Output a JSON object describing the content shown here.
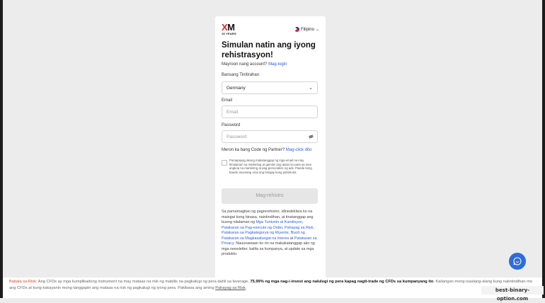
{
  "logo": {
    "mark_x": "X",
    "mark_m": "M",
    "years": "15 YEARS"
  },
  "language": {
    "label": "Filipino"
  },
  "form": {
    "title": "Simulan natin ang iyong rehistrasyon!",
    "login_prompt": "Mayroon nang account?",
    "login_link": "Mag-login",
    "country_label": "Bansang Tinitirahan",
    "country_value": "Germany",
    "email_label": "Email",
    "email_placeholder": "Email",
    "password_label": "Password",
    "password_placeholder": "Password",
    "partner_prompt": "Meron ka bang Code ng Partner?",
    "partner_link": "Mag-click dito",
    "consent_text": "Pumapayag akong makatanggap ng mga email na may kinalaman sa marketing at gamitin ang datos ko para sa mas angkop na marketing at pag-personalize ng ads. Pwede kong bawiin anumang oras ang binigay kong pahintulot.",
    "consent_checked": false,
    "submit_label": "Mag-rehistro",
    "legal_pre": "Sa pamamagitan ng pagrerehistro, idinedeklara ko na maingat kong binasa, naintindihan, at tinatanggap ang buong nilalaman ng ",
    "legal_links": "Mga Tuntunin at Kundisyon, Patakaran sa Pag-execute ng Order, Pahayag sa Risk, Patakaran sa Pagkategorya ng Kliyente, Buod ng Patakaran sa Magkasalungat na Interes",
    "legal_mid": " at ",
    "legal_privacy": "Patakaran sa Privacy",
    "legal_post": ". Nauunawaan ko rin na makakatanggap ako ng mga newsletter, balita sa kumpanya, at update sa mga produkto."
  },
  "risk_warning": {
    "label": "Babala sa Risk:",
    "text1": " Ang CFDs ay mga kumplikadong instrument na may mataas na risk ng mabilis na pagkalugi ng pera dahil sa leverage. ",
    "bold": "75.99% ng mga nag-i-invest ang nalulugi ng pera kapag nagti-trade ng CFDs sa kumpanyang ito",
    "text2": ". Kailangan mong isaalang-alang kung naiintindihan mo ang CFDs at kung kakayanin mong tanggapin ang mataas na risk ng pagkalugi ng iyong pera. Pakibasa ang aming ",
    "link": "Pahayag sa Risk",
    "end": "."
  },
  "watermark": "best-binary-option.com",
  "colors": {
    "link": "#2b5fd9",
    "chat": "#2f6cd8",
    "risk_label": "#d24b2b"
  }
}
